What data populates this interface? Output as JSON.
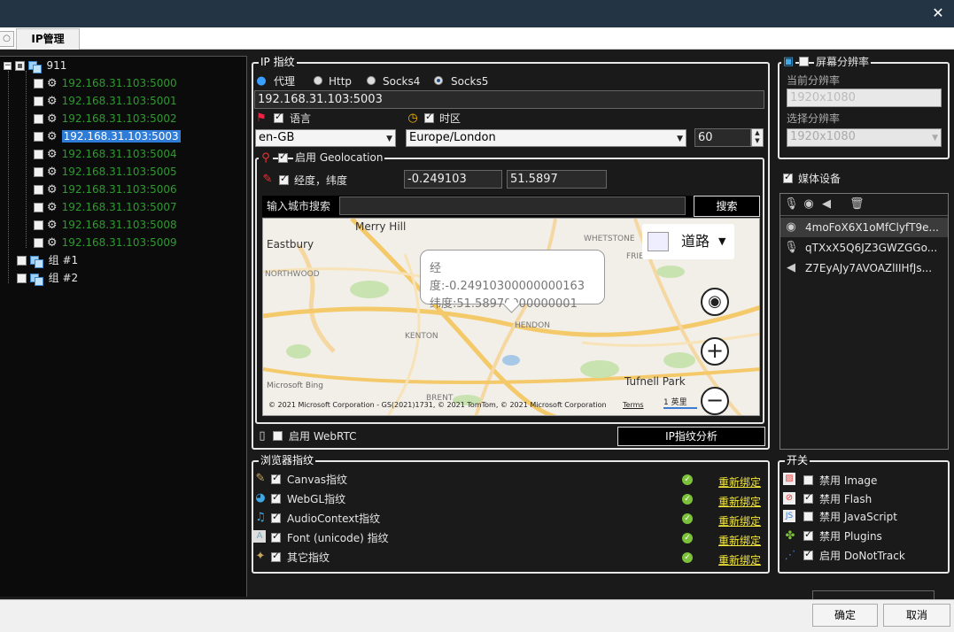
{
  "tab": {
    "stub": "○",
    "active": "IP管理"
  },
  "tree": {
    "root": "911",
    "ips": [
      "192.168.31.103:5000",
      "192.168.31.103:5001",
      "192.168.31.103:5002",
      "192.168.31.103:5003",
      "192.168.31.103:5004",
      "192.168.31.103:5005",
      "192.168.31.103:5006",
      "192.168.31.103:5007",
      "192.168.31.103:5008",
      "192.168.31.103:5009"
    ],
    "groups": [
      "组 #1",
      "组 #2"
    ]
  },
  "ipfp": {
    "legend": "IP 指纹",
    "proxy": "代理",
    "http": "Http",
    "socks4": "Socks4",
    "socks5": "Socks5",
    "address": "192.168.31.103:5003",
    "language_label": "语言",
    "language": "en-GB",
    "timezone_label": "时区",
    "timezone": "Europe/London",
    "tz_offset": "60",
    "geo_label": "启用 Geolocation",
    "lonlat_label": "经度，纬度",
    "lon": "-0.249103",
    "lat": "51.5897",
    "city_label": "输入城市搜索",
    "search": "搜索",
    "webrtc": "启用 WebRTC",
    "analyze": "IP指纹分析"
  },
  "map": {
    "popup_lon": "经度:-0.24910300000000163",
    "popup_lat": "纬度:51.58970000000001",
    "road": "道路",
    "labels": [
      "Merry Hill",
      "Eastbury",
      "Tufnell Park"
    ],
    "sublabels": [
      "WHETSTONE",
      "FRIERN BARNET",
      "NORTHWOOD",
      "KENTON",
      "HENDON",
      "BRENT"
    ],
    "brand": "Microsoft Bing",
    "copyright": "© 2021 Microsoft Corporation - GS(2021)1731, © 2021 TomTom, © 2021 Microsoft Corporation",
    "terms": "Terms",
    "scale": "1 英里"
  },
  "browser": {
    "legend": "浏览器指纹",
    "items": [
      "Canvas指纹",
      "WebGL指纹",
      "AudioContext指纹",
      "Font (unicode) 指纹",
      "其它指纹"
    ],
    "rebind": "重新绑定"
  },
  "screen": {
    "legend": "屏幕分辨率",
    "current_label": "当前分辨率",
    "current": "1920x1080",
    "select_label": "选择分辨率",
    "select": "1920x1080"
  },
  "media": {
    "label": "媒体设备",
    "items": [
      "4moFoX6X1oMfClyfT9e...",
      "qTXxX5Q6JZ3GWZGGo...",
      "Z7EyAJy7AVOAZlIIHfJs..."
    ]
  },
  "switches": {
    "legend": "开关",
    "items": [
      "禁用 Image",
      "禁用 Flash",
      "禁用 JavaScript",
      "禁用 Plugins",
      "启用 DoNotTrack"
    ]
  },
  "footer": {
    "ok": "确定",
    "cancel": "取消"
  }
}
